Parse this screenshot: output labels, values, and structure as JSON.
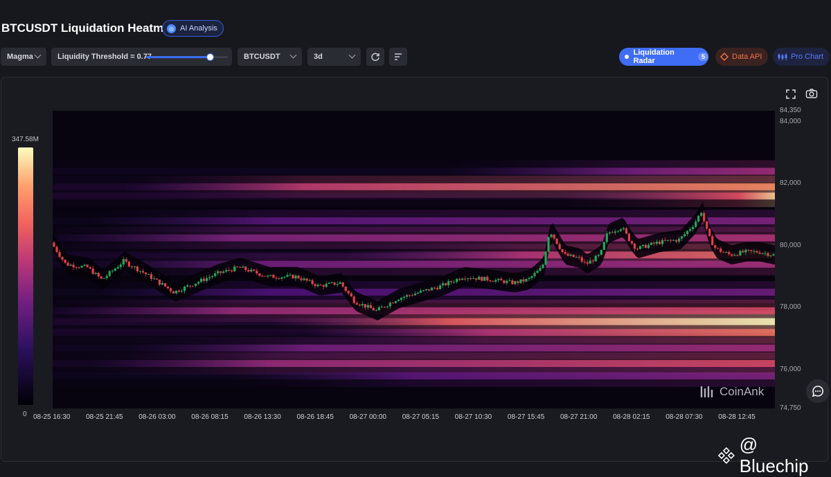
{
  "header": {
    "title": "BTCUSDT Liquidation Heatmap",
    "ai_button": "AI Analysis"
  },
  "toolbar": {
    "colormap": "Magma",
    "threshold_label": "Liquidity Threshold = 0.77",
    "threshold_value": 0.77,
    "symbol": "BTCUSDT",
    "timeframe": "3d",
    "radar_label": "Liquidation Radar",
    "radar_count": "5",
    "data_api": "Data API",
    "pro_chart": "Pro Chart"
  },
  "legend": {
    "max": "347.58M",
    "min": "0"
  },
  "watermark": "CoinAnk",
  "credit": "@ Bluechip",
  "colors": {
    "accent": "#3f6df5",
    "bull": "#26a65b",
    "bear": "#e0404a",
    "data_api": "#f0754a"
  },
  "chart_data": {
    "type": "heatmap",
    "title": "BTCUSDT Liquidation Heatmap",
    "ylim": [
      74750,
      84350
    ],
    "y_ticks": [
      "84,350",
      "84,000",
      "82,000",
      "80,000",
      "78,000",
      "76,000",
      "74,750"
    ],
    "y_tick_values": [
      84350,
      84000,
      82000,
      80000,
      78000,
      76000,
      74750
    ],
    "x_ticks": [
      "08-25 16:30",
      "08-25 21:45",
      "08-26 03:00",
      "08-26 08:15",
      "08-26 13:30",
      "08-26 18:45",
      "08-27 00:00",
      "08-27 05:15",
      "08-27 10:30",
      "08-27 15:45",
      "08-27 21:00",
      "08-28 02:15",
      "08-28 07:30",
      "08-28 12:45"
    ],
    "liquidation_bands": [
      {
        "price": 82400,
        "intensity": 0.55,
        "start": 0.55
      },
      {
        "price": 81900,
        "intensity": 0.85,
        "start": 0.1
      },
      {
        "price": 81600,
        "intensity": 0.95,
        "start": 0.7
      },
      {
        "price": 80800,
        "intensity": 0.45,
        "start": 0.05
      },
      {
        "price": 80250,
        "intensity": 0.6,
        "start": 0.0
      },
      {
        "price": 79700,
        "intensity": 0.8,
        "start": 0.4
      },
      {
        "price": 79400,
        "intensity": 0.55,
        "start": 0.05
      },
      {
        "price": 78500,
        "intensity": 0.4,
        "start": 0.05
      },
      {
        "price": 77900,
        "intensity": 0.7,
        "start": 0.0
      },
      {
        "price": 77550,
        "intensity": 1.0,
        "start": 0.3
      },
      {
        "price": 77200,
        "intensity": 0.8,
        "start": 0.35
      },
      {
        "price": 76700,
        "intensity": 0.55,
        "start": 0.1
      },
      {
        "price": 76200,
        "intensity": 0.7,
        "start": 0.05
      },
      {
        "price": 75800,
        "intensity": 0.45,
        "start": 0.25
      }
    ],
    "price_path": [
      [
        0,
        80100
      ],
      [
        0.02,
        79400
      ],
      [
        0.05,
        79300
      ],
      [
        0.07,
        78900
      ],
      [
        0.1,
        79500
      ],
      [
        0.13,
        79100
      ],
      [
        0.17,
        78500
      ],
      [
        0.2,
        78800
      ],
      [
        0.23,
        79100
      ],
      [
        0.26,
        79300
      ],
      [
        0.3,
        79000
      ],
      [
        0.34,
        79000
      ],
      [
        0.37,
        78700
      ],
      [
        0.4,
        78800
      ],
      [
        0.42,
        78200
      ],
      [
        0.45,
        77900
      ],
      [
        0.48,
        78300
      ],
      [
        0.51,
        78500
      ],
      [
        0.54,
        78700
      ],
      [
        0.57,
        79000
      ],
      [
        0.61,
        78900
      ],
      [
        0.64,
        78800
      ],
      [
        0.66,
        78900
      ],
      [
        0.68,
        79300
      ],
      [
        0.69,
        80500
      ],
      [
        0.71,
        79700
      ],
      [
        0.73,
        79600
      ],
      [
        0.74,
        79400
      ],
      [
        0.76,
        79700
      ],
      [
        0.77,
        80400
      ],
      [
        0.79,
        80600
      ],
      [
        0.8,
        80200
      ],
      [
        0.81,
        79900
      ],
      [
        0.84,
        80100
      ],
      [
        0.87,
        80200
      ],
      [
        0.89,
        80700
      ],
      [
        0.9,
        81100
      ],
      [
        0.91,
        80300
      ],
      [
        0.92,
        79900
      ],
      [
        0.94,
        79700
      ],
      [
        0.96,
        79800
      ],
      [
        0.98,
        79800
      ],
      [
        1.0,
        79700
      ]
    ]
  }
}
